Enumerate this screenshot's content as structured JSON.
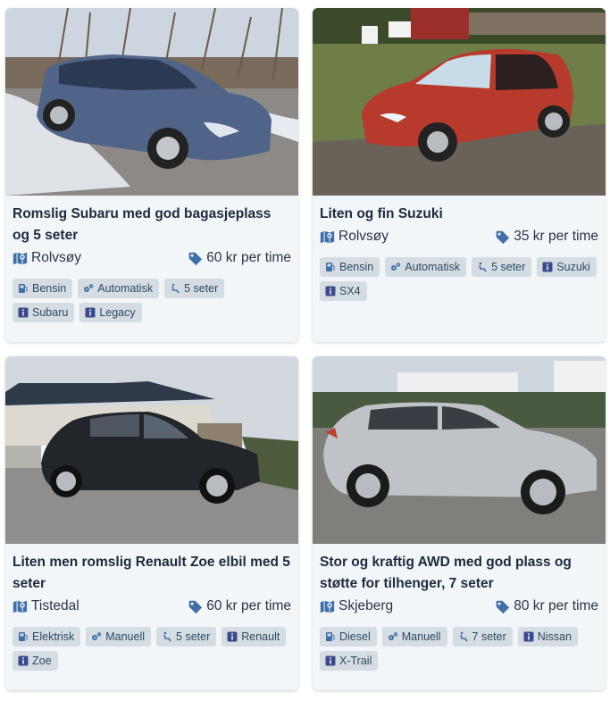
{
  "listings": [
    {
      "title": "Romslig Subaru med god bagasjeplass og 5 seter",
      "location": "Rolvsøy",
      "price": "60 kr per time",
      "tags": [
        {
          "icon": "fuel-icon",
          "label": "Bensin"
        },
        {
          "icon": "gears-icon",
          "label": "Automatisk"
        },
        {
          "icon": "seat-icon",
          "label": "5 seter"
        },
        {
          "icon": "info-icon",
          "label": "Subaru"
        },
        {
          "icon": "info-icon",
          "label": "Legacy"
        }
      ],
      "photo_colors": {
        "sky": "#c9d3de",
        "ground": "#8d8a88",
        "car": "#4d6487"
      }
    },
    {
      "title": "Liten og fin Suzuki",
      "location": "Rolvsøy",
      "price": "35 kr per time",
      "tags": [
        {
          "icon": "fuel-icon",
          "label": "Bensin"
        },
        {
          "icon": "gears-icon",
          "label": "Automatisk"
        },
        {
          "icon": "seat-icon",
          "label": "5 seter"
        },
        {
          "icon": "info-icon",
          "label": "Suzuki"
        },
        {
          "icon": "info-icon",
          "label": "SX4"
        }
      ],
      "photo_colors": {
        "sky": "#5b6f3f",
        "ground": "#6f7c4a",
        "car": "#b8372c"
      }
    },
    {
      "title": "Liten men romslig Renault Zoe elbil med 5 seter",
      "location": "Tistedal",
      "price": "60 kr per time",
      "tags": [
        {
          "icon": "fuel-icon",
          "label": "Elektrisk"
        },
        {
          "icon": "gears-icon",
          "label": "Manuell"
        },
        {
          "icon": "seat-icon",
          "label": "5 seter"
        },
        {
          "icon": "info-icon",
          "label": "Renault"
        },
        {
          "icon": "info-icon",
          "label": "Zoe"
        }
      ],
      "photo_colors": {
        "sky": "#d4d8de",
        "ground": "#8e8d8c",
        "car": "#23272c"
      }
    },
    {
      "title": "Stor og kraftig AWD med god plass og støtte for tilhenger, 7 seter",
      "location": "Skjeberg",
      "price": "80 kr per time",
      "tags": [
        {
          "icon": "fuel-icon",
          "label": "Diesel"
        },
        {
          "icon": "gears-icon",
          "label": "Manuell"
        },
        {
          "icon": "seat-icon",
          "label": "7 seter"
        },
        {
          "icon": "info-icon",
          "label": "Nissan"
        },
        {
          "icon": "info-icon",
          "label": "X-Trail"
        }
      ],
      "photo_colors": {
        "sky": "#cfd6de",
        "ground": "#7f7e7b",
        "car": "#bcbfc3"
      }
    }
  ],
  "colors": {
    "card_bg": "#f3f6f8",
    "tag_bg": "#d5dde2",
    "icon_accent": "#3f6fa8"
  }
}
